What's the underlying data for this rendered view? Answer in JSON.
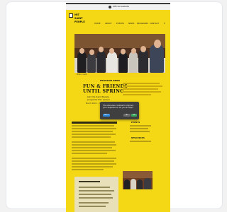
{
  "header": {
    "tagline": "Official website",
    "brand": [
      "MIT",
      "SAINT",
      "PEOPLE"
    ],
    "nav": [
      "HOME",
      "ABOUT",
      "EVENTS",
      "NEWS",
      "PROGRAMS",
      "CONTACT"
    ]
  },
  "hero": {
    "caption": "Photo credit"
  },
  "article": {
    "kicker": "PROGRAM NEWS",
    "headline_line1": "FUN & FRIENDS",
    "headline_line2": "UNTIL SPRING",
    "sub_line1": "Join the Saint People",
    "sub_line2": "programs this season",
    "date": "March 2024 · Updates"
  },
  "dialog": {
    "message": "This site uses cookies to improve your experience. Do you accept?",
    "more_label": "More",
    "decline_label": "No",
    "accept_label": "OK"
  },
  "sidebar": {
    "section1_title": "EVENTS",
    "section2_title": "RESOURCES"
  },
  "colors": {
    "brand_yellow": "#f4d816",
    "dialog_bg": "#3f3f3f",
    "accept_button": "#3aa35c",
    "more_button": "#2f86d6"
  }
}
